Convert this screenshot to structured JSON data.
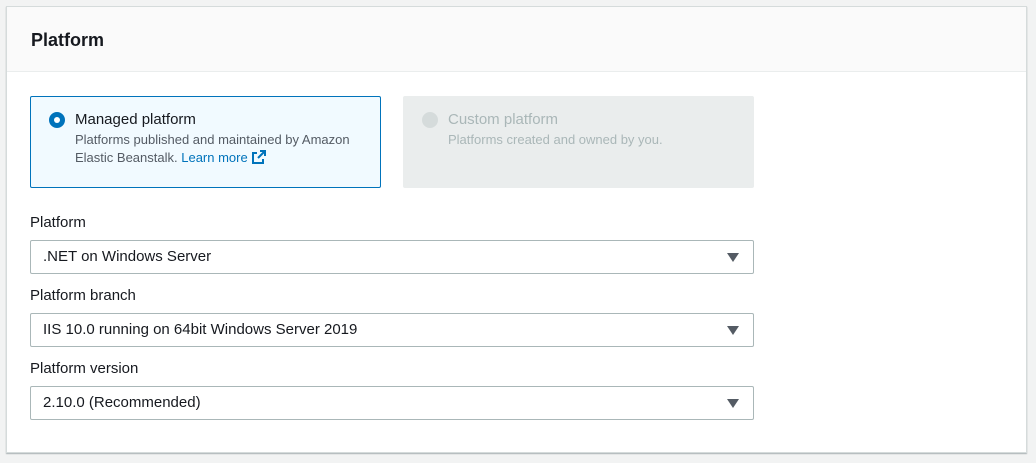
{
  "panel": {
    "title": "Platform"
  },
  "platform_type": {
    "managed": {
      "title": "Managed platform",
      "description": "Platforms published and maintained by Amazon Elastic Beanstalk.",
      "link": "Learn more",
      "selected": true
    },
    "custom": {
      "title": "Custom platform",
      "description": "Platforms created and owned by you.",
      "disabled": true
    }
  },
  "fields": {
    "platform": {
      "label": "Platform",
      "value": ".NET on Windows Server"
    },
    "branch": {
      "label": "Platform branch",
      "value": "IIS 10.0 running on 64bit Windows Server 2019"
    },
    "version": {
      "label": "Platform version",
      "value": "2.10.0 (Recommended)"
    }
  },
  "colors": {
    "accent": "#0073bb",
    "selected_tile_bg": "#f1faff",
    "disabled_tile_bg": "#eaeded"
  },
  "icons": {
    "external_link": "external-link-icon",
    "dropdown": "caret-down-icon",
    "radio": "radio-icon"
  }
}
